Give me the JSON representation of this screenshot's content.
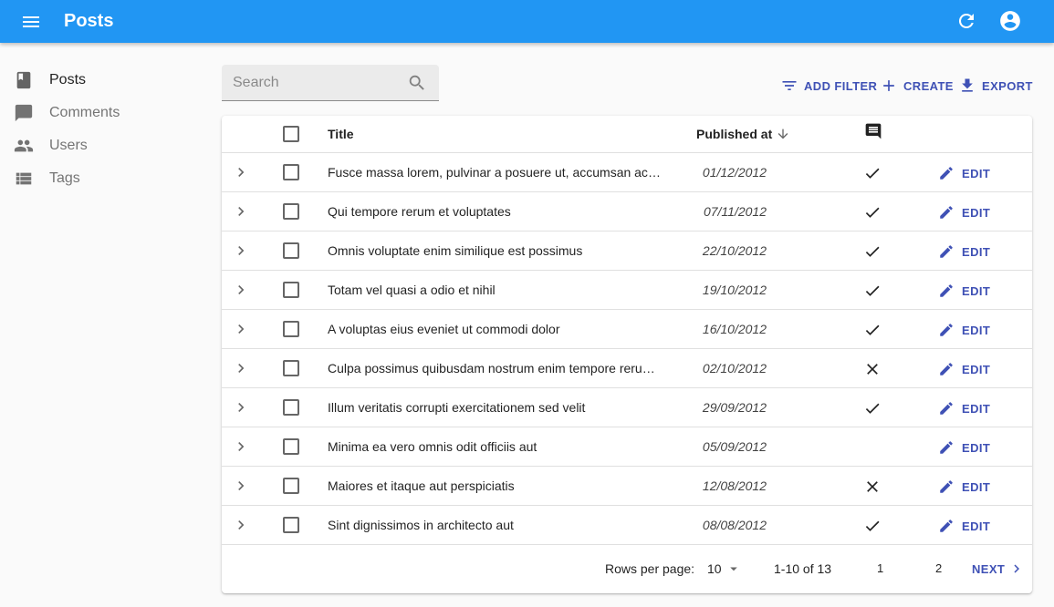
{
  "app": {
    "title": "Posts"
  },
  "sidebar": {
    "items": [
      {
        "label": "Posts",
        "icon": "book-icon"
      },
      {
        "label": "Comments",
        "icon": "comment-icon"
      },
      {
        "label": "Users",
        "icon": "people-icon"
      },
      {
        "label": "Tags",
        "icon": "list-icon"
      }
    ]
  },
  "search": {
    "placeholder": "Search",
    "value": ""
  },
  "toolbar": {
    "add_filter": "ADD FILTER",
    "create": "CREATE",
    "export": "EXPORT"
  },
  "table": {
    "headers": {
      "title": "Title",
      "published": "Published at",
      "comments_icon": "comment-icon"
    },
    "edit_label": "EDIT",
    "rows": [
      {
        "title": "Fusce massa lorem, pulvinar a posuere ut, accumsan ac nisi",
        "published": "01/12/2012",
        "commentable": "check"
      },
      {
        "title": "Qui tempore rerum et voluptates",
        "published": "07/11/2012",
        "commentable": "check"
      },
      {
        "title": "Omnis voluptate enim similique est possimus",
        "published": "22/10/2012",
        "commentable": "check"
      },
      {
        "title": "Totam vel quasi a odio et nihil",
        "published": "19/10/2012",
        "commentable": "check"
      },
      {
        "title": "A voluptas eius eveniet ut commodi dolor",
        "published": "16/10/2012",
        "commentable": "check"
      },
      {
        "title": "Culpa possimus quibusdam nostrum enim tempore rerum odit excepturi",
        "published": "02/10/2012",
        "commentable": "cross"
      },
      {
        "title": "Illum veritatis corrupti exercitationem sed velit",
        "published": "29/09/2012",
        "commentable": "check"
      },
      {
        "title": "Minima ea vero omnis odit officiis aut",
        "published": "05/09/2012",
        "commentable": "none"
      },
      {
        "title": "Maiores et itaque aut perspiciatis",
        "published": "12/08/2012",
        "commentable": "cross"
      },
      {
        "title": "Sint dignissimos in architecto aut",
        "published": "08/08/2012",
        "commentable": "check"
      }
    ]
  },
  "pagination": {
    "rows_per_page_label": "Rows per page:",
    "rows_per_page": "10",
    "range": "1-10 of 13",
    "pages": [
      "1",
      "2"
    ],
    "next": "NEXT"
  },
  "colors": {
    "appbar": "#2196f3",
    "accent": "#3f51b5"
  }
}
